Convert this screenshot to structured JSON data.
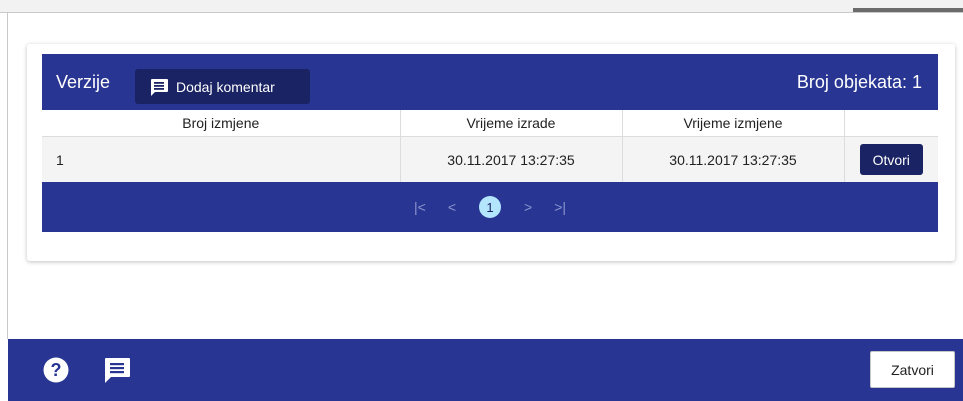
{
  "panel": {
    "title": "Verzije",
    "add_comment_label": "Dodaj komentar",
    "object_count": "Broj objekata: 1"
  },
  "table": {
    "headers": [
      "Broj izmjene",
      "Vrijeme izrade",
      "Vrijeme izmjene",
      ""
    ],
    "rows": [
      {
        "number": "1",
        "created": "30.11.2017 13:27:35",
        "modified": "30.11.2017 13:27:35",
        "action": "Otvori"
      }
    ]
  },
  "pager": {
    "first": "|<",
    "prev": "<",
    "current": "1",
    "next": ">",
    "last": ">|"
  },
  "footer": {
    "close_label": "Zatvori",
    "help_icon": "help-icon",
    "comment_icon": "comment-icon"
  },
  "colors": {
    "primary": "#283593",
    "primary_dark": "#1a2363",
    "page_highlight": "#b3e5fc"
  }
}
